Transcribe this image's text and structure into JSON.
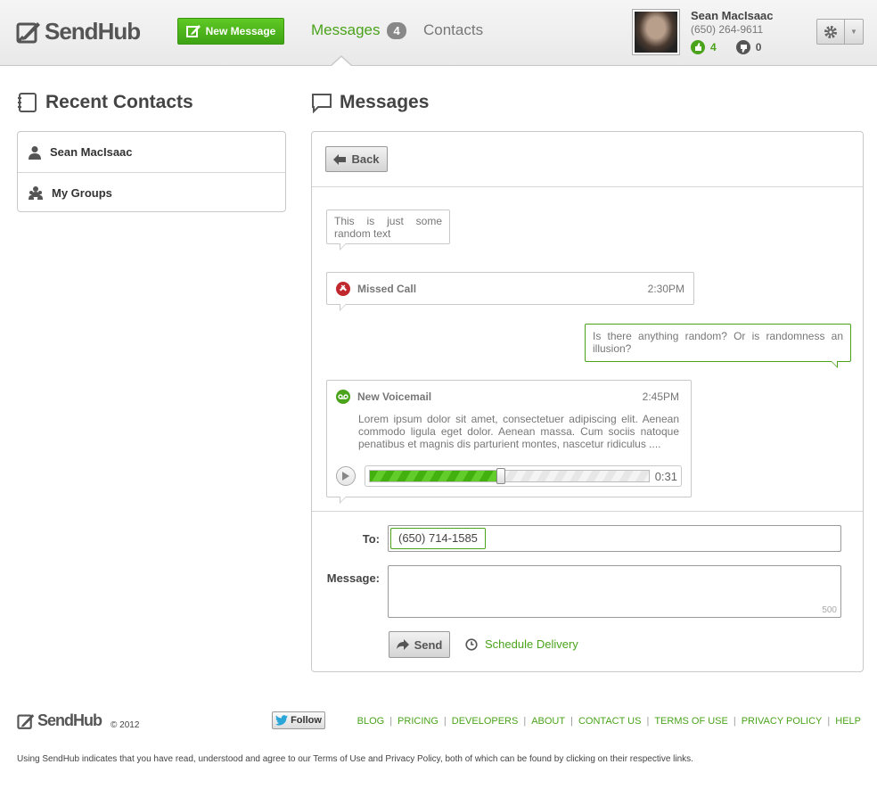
{
  "brand": {
    "name": "SendHub",
    "copyright": "© 2012"
  },
  "header": {
    "new_message_label": "New Message",
    "nav_messages": "Messages",
    "messages_badge": "4",
    "nav_contacts": "Contacts",
    "user_name": "Sean MacIsaac",
    "user_phone": "(650) 264-9611",
    "likes": "4",
    "dislikes": "0"
  },
  "left": {
    "title": "Recent Contacts",
    "items": [
      {
        "label": "Sean MacIsaac",
        "icon": "person-icon"
      },
      {
        "label": "My Groups",
        "icon": "group-icon"
      }
    ]
  },
  "main": {
    "title": "Messages",
    "back_label": "Back",
    "thread": {
      "msg1": "This is just some random text",
      "missed_label": "Missed Call",
      "missed_time": "2:30PM",
      "msg2": "Is there anything random? Or is randomness an illusion?",
      "voicemail_label": "New Voicemail",
      "voicemail_time": "2:45PM",
      "voicemail_text": "Lorem ipsum dolor sit amet, consectetuer adipiscing elit. Aenean commodo ligula eget dolor. Aenean massa. Cum sociis natoque penatibus et magnis dis parturient montes, nascetur ridiculus ....",
      "voicemail_progress": 0.47,
      "voicemail_duration": "0:31"
    },
    "compose": {
      "to_label": "To:",
      "to_value": "(650) 714-1585",
      "message_label": "Message:",
      "char_count": "500",
      "send_label": "Send",
      "schedule_label": "Schedule Delivery"
    }
  },
  "footer": {
    "follow_label": "Follow",
    "links": [
      "BLOG",
      "PRICING",
      "DEVELOPERS",
      "ABOUT",
      "CONTACT US",
      "TERMS OF USE",
      "PRIVACY POLICY",
      "HELP"
    ],
    "legal": "Using SendHub indicates that you have read, understood and agree to our Terms of Use and Privacy Policy, both of which can be found by clicking on their respective links."
  },
  "colors": {
    "accent": "#4aa31b",
    "button_green": "#4fb81c",
    "missed": "#c0282e"
  }
}
